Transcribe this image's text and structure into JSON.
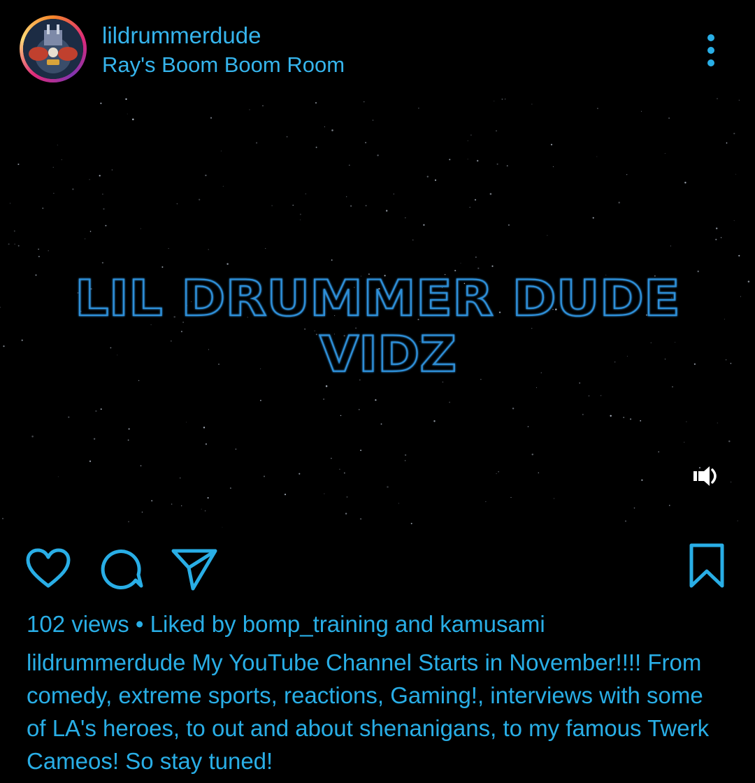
{
  "post": {
    "username": "lildrummerdude",
    "location": "Ray's Boom Boom Room"
  },
  "media": {
    "title_line1": "LIL DRUMMER DUDE",
    "title_line2": "VIDZ",
    "type": "video"
  },
  "actions": {
    "like_icon": "heart-icon",
    "comment_icon": "comment-icon",
    "share_icon": "paper-plane-icon",
    "save_icon": "bookmark-icon",
    "more_icon": "more-vertical-icon",
    "volume_icon": "volume-icon"
  },
  "stats": {
    "views": "102 views",
    "separator": " • ",
    "liked_by_prefix": "Liked by ",
    "liked_user_1": "bomp_training",
    "and_text": " and ",
    "liked_user_2": "kamusami"
  },
  "caption": {
    "author": "lildrummerdude",
    "text": " My YouTube Channel Starts in November!!!! From comedy, extreme sports, reactions, Gaming!, interviews with some of LA's heroes, to out and about shenanigans, to my famous Twerk Cameos! So stay tuned!"
  },
  "colors": {
    "accent": "#29aee6",
    "background": "#000000",
    "title_outline": "#2f8fd8"
  }
}
